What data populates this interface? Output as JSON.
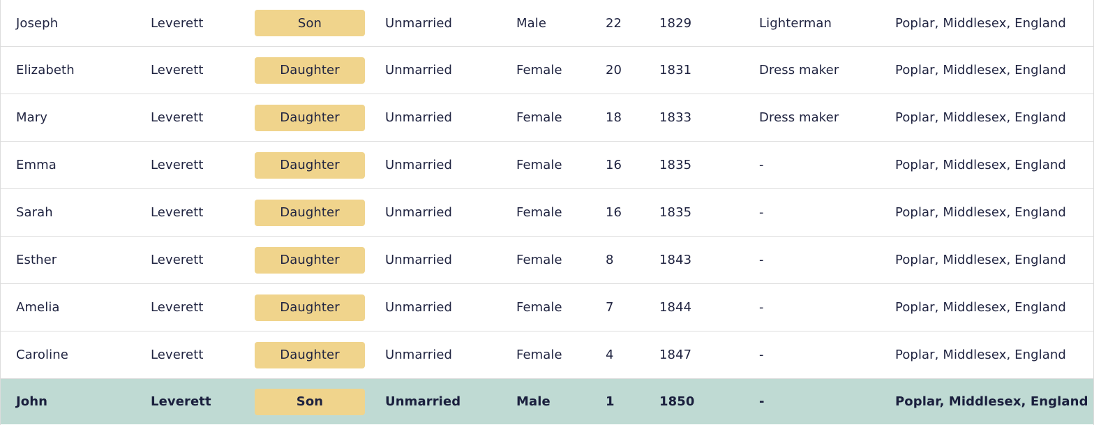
{
  "rows": [
    {
      "first": "Joseph",
      "last": "Leverett",
      "relation": "Son",
      "condition": "Unmarried",
      "sex": "Male",
      "age": "22",
      "born": "1829",
      "occupation": "Lighterman",
      "birthplace": "Poplar, Middlesex, England",
      "highlighted": false
    },
    {
      "first": "Elizabeth",
      "last": "Leverett",
      "relation": "Daughter",
      "condition": "Unmarried",
      "sex": "Female",
      "age": "20",
      "born": "1831",
      "occupation": "Dress maker",
      "birthplace": "Poplar, Middlesex, England",
      "highlighted": false
    },
    {
      "first": "Mary",
      "last": "Leverett",
      "relation": "Daughter",
      "condition": "Unmarried",
      "sex": "Female",
      "age": "18",
      "born": "1833",
      "occupation": "Dress maker",
      "birthplace": "Poplar, Middlesex, England",
      "highlighted": false
    },
    {
      "first": "Emma",
      "last": "Leverett",
      "relation": "Daughter",
      "condition": "Unmarried",
      "sex": "Female",
      "age": "16",
      "born": "1835",
      "occupation": "-",
      "birthplace": "Poplar, Middlesex, England",
      "highlighted": false
    },
    {
      "first": "Sarah",
      "last": "Leverett",
      "relation": "Daughter",
      "condition": "Unmarried",
      "sex": "Female",
      "age": "16",
      "born": "1835",
      "occupation": "-",
      "birthplace": "Poplar, Middlesex, England",
      "highlighted": false
    },
    {
      "first": "Esther",
      "last": "Leverett",
      "relation": "Daughter",
      "condition": "Unmarried",
      "sex": "Female",
      "age": "8",
      "born": "1843",
      "occupation": "-",
      "birthplace": "Poplar, Middlesex, England",
      "highlighted": false
    },
    {
      "first": "Amelia",
      "last": "Leverett",
      "relation": "Daughter",
      "condition": "Unmarried",
      "sex": "Female",
      "age": "7",
      "born": "1844",
      "occupation": "-",
      "birthplace": "Poplar, Middlesex, England",
      "highlighted": false
    },
    {
      "first": "Caroline",
      "last": "Leverett",
      "relation": "Daughter",
      "condition": "Unmarried",
      "sex": "Female",
      "age": "4",
      "born": "1847",
      "occupation": "-",
      "birthplace": "Poplar, Middlesex, England",
      "highlighted": false
    },
    {
      "first": "John",
      "last": "Leverett",
      "relation": "Son",
      "condition": "Unmarried",
      "sex": "Male",
      "age": "1",
      "born": "1850",
      "occupation": "-",
      "birthplace": "Poplar, Middlesex, England",
      "highlighted": true
    }
  ],
  "colors": {
    "badge": "#f0d48c",
    "highlight_row": "#bfdad3",
    "text": "#1f2340",
    "divider": "#dedede"
  }
}
